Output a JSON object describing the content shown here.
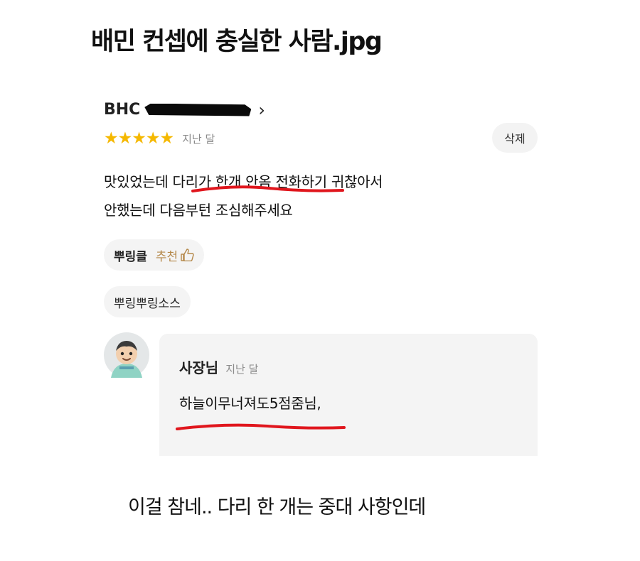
{
  "post": {
    "title": "배민 컨셉에 충실한 사람.jpg",
    "caption": "이걸 참네.. 다리 한 개는 중대 사항인데"
  },
  "review": {
    "store_name": "BHC",
    "stars": "★★★★★",
    "rating": 5,
    "date": "지난 달",
    "delete_label": "삭제",
    "text_line1": "맛있었는데 다리가 한개 안옴 전화하기 귀찮아서",
    "text_line2": "안했는데 다음부턴 조심해주세요",
    "menu_tag": {
      "name": "뿌링클",
      "recommend": "추천"
    },
    "sauce_tag": "뿌링뿌링소스"
  },
  "reply": {
    "author": "사장님",
    "date": "지난 달",
    "text": "하늘이무너져도5점줌님,"
  },
  "colors": {
    "star": "#f5b800",
    "recommend": "#b5894b",
    "underline": "#e0161d"
  }
}
